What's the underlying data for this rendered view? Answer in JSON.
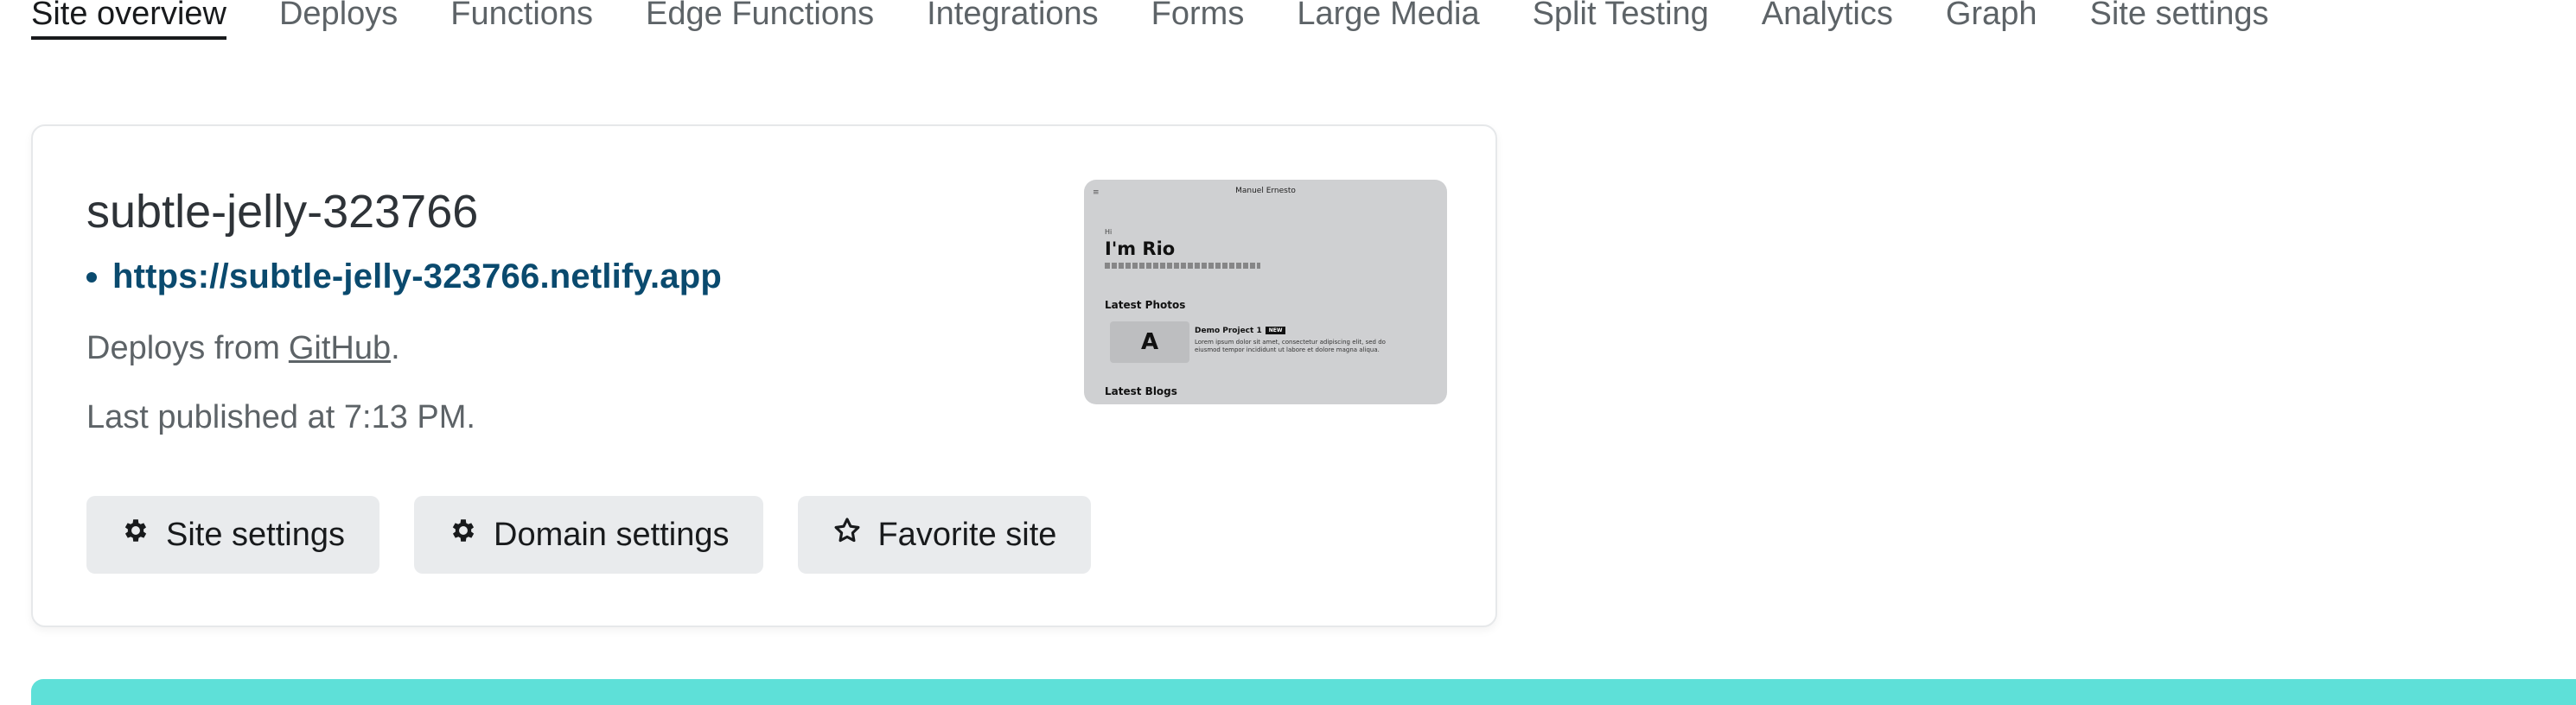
{
  "tabs": [
    {
      "label": "Site overview",
      "active": true
    },
    {
      "label": "Deploys"
    },
    {
      "label": "Functions"
    },
    {
      "label": "Edge Functions"
    },
    {
      "label": "Integrations"
    },
    {
      "label": "Forms"
    },
    {
      "label": "Large Media"
    },
    {
      "label": "Split Testing"
    },
    {
      "label": "Analytics"
    },
    {
      "label": "Graph"
    },
    {
      "label": "Site settings"
    }
  ],
  "site": {
    "name": "subtle-jelly-323766",
    "url": "https://subtle-jelly-323766.netlify.app",
    "deploys_prefix": "Deploys from",
    "deploys_source": "GitHub",
    "deploys_suffix": ".",
    "published": "Last published at 7:13 PM."
  },
  "buttons": {
    "site_settings": "Site settings",
    "domain_settings": "Domain settings",
    "favorite_site": "Favorite site"
  },
  "icons": {
    "site_settings": "gear-icon",
    "domain_settings": "gear-icon",
    "favorite_site": "star-icon"
  },
  "preview": {
    "menu": "≡",
    "author": "Manuel Ernesto",
    "greeting": "Hi",
    "title": "I'm Rio",
    "latest_photos": "Latest Photos",
    "project_title": "Demo Project 1",
    "project_badge": "NEW",
    "project_logo": "A",
    "project_text": "Lorem ipsum dolor sit amet, consectetur adipiscing elit, sed do eiusmod tempor incididunt ut labore et dolore magna aliqua.",
    "latest_blogs": "Latest Blogs"
  },
  "colors": {
    "link": "#0a4a6e",
    "button_bg": "#e9ebed",
    "accent_bar": "#5ee0d8"
  }
}
